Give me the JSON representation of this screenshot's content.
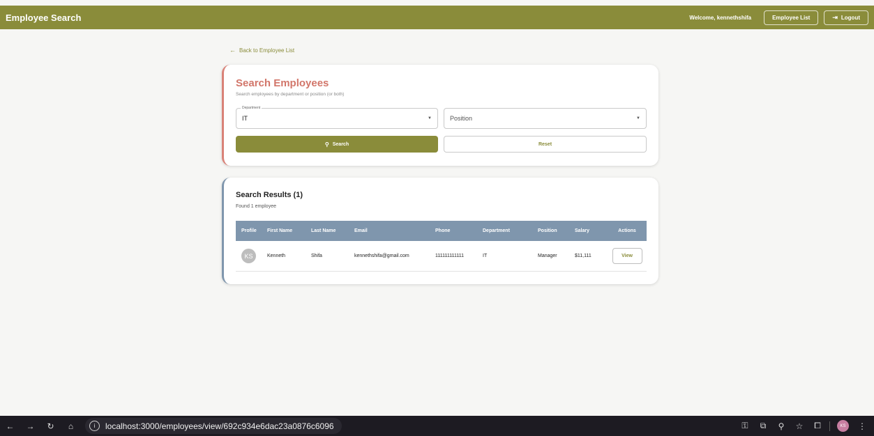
{
  "header": {
    "app_title": "Employee Search",
    "welcome": "Welcome, kennethshifa",
    "employee_list_label": "Employee List",
    "logout_label": "Logout"
  },
  "back_link": "Back to Employee List",
  "search_card": {
    "title": "Search Employees",
    "subtitle": "Search employees by department or position (or both)",
    "department_label": "Department",
    "department_value": "IT",
    "position_placeholder": "Position",
    "search_label": "Search",
    "reset_label": "Reset"
  },
  "results": {
    "title": "Search Results (1)",
    "count": "Found 1 employee",
    "columns": [
      "Profile",
      "First Name",
      "Last Name",
      "Email",
      "Phone",
      "Department",
      "Position",
      "Salary",
      "Actions"
    ],
    "rows": [
      {
        "initials": "KS",
        "first_name": "Kenneth",
        "last_name": "Shifa",
        "email": "kennethshifa@gmail.com",
        "phone": "111111111111",
        "department": "IT",
        "position": "Manager",
        "salary": "$11,111",
        "action": "View"
      }
    ]
  },
  "browser": {
    "url": "localhost:3000/employees/view/692c934e6dac23a0876c6096",
    "profile_initials": "KS"
  },
  "colors": {
    "brand": "#8a8c3a",
    "accent_search": "#d2766a",
    "table_header": "#7f96ad",
    "browser_bar": "#1d1b22"
  }
}
